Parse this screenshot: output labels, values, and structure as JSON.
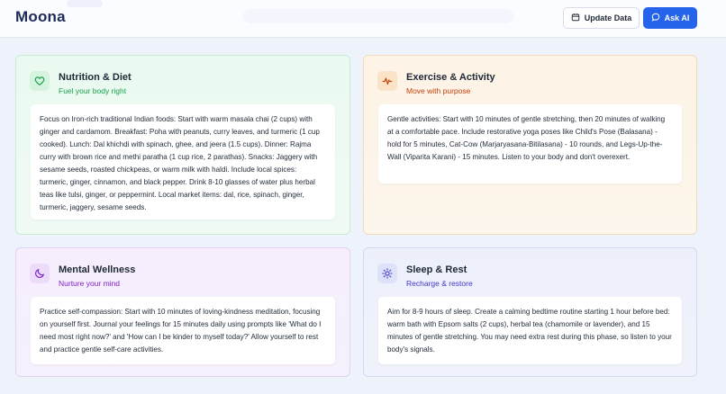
{
  "header": {
    "brand": "Moona",
    "update_label": "Update Data",
    "ask_ai_label": "Ask AI"
  },
  "cards": {
    "nutrition": {
      "title": "Nutrition & Diet",
      "subtitle": "Fuel your body right",
      "icon": "heart-icon",
      "accent": "#16a34a",
      "body": "Focus on Iron-rich traditional Indian foods: Start with warm masala chai (2 cups) with ginger and cardamom. Breakfast: Poha with peanuts, curry leaves, and turmeric (1 cup cooked). Lunch: Dal khichdi with spinach, ghee, and jeera (1.5 cups). Dinner: Rajma curry with brown rice and methi paratha (1 cup rice, 2 parathas). Snacks: Jaggery with sesame seeds, roasted chickpeas, or warm milk with haldi. Include local spices: turmeric, ginger, cinnamon, and black pepper. Drink 8-10 glasses of water plus herbal teas like tulsi, ginger, or peppermint. Local market items: dal, rice, spinach, ginger, turmeric, jaggery, sesame seeds."
    },
    "exercise": {
      "title": "Exercise & Activity",
      "subtitle": "Move with purpose",
      "icon": "activity-pulse-icon",
      "accent": "#c2410c",
      "body": "Gentle activities: Start with 10 minutes of gentle stretching, then 20 minutes of walking at a comfortable pace. Include restorative yoga poses like Child's Pose (Balasana) - hold for 5 minutes, Cat-Cow (Marjaryasana-Bitilasana) - 10 rounds, and Legs-Up-the-Wall (Viparita Karani) - 15 minutes. Listen to your body and don't overexert."
    },
    "mental": {
      "title": "Mental Wellness",
      "subtitle": "Nurture your mind",
      "icon": "moon-icon",
      "accent": "#7e22ce",
      "body": "Practice self-compassion: Start with 10 minutes of loving-kindness meditation, focusing on yourself first. Journal your feelings for 15 minutes daily using prompts like 'What do I need most right now?' and 'How can I be kinder to myself today?' Allow yourself to rest and practice gentle self-care activities."
    },
    "sleep": {
      "title": "Sleep & Rest",
      "subtitle": "Recharge & restore",
      "icon": "sun-icon",
      "accent": "#4338ca",
      "body": "Aim for 8-9 hours of sleep. Create a calming bedtime routine starting 1 hour before bed: warm bath with Epsom salts (2 cups), herbal tea (chamomile or lavender), and 15 minutes of gentle stretching. You may need extra rest during this phase, so listen to your body's signals."
    }
  }
}
